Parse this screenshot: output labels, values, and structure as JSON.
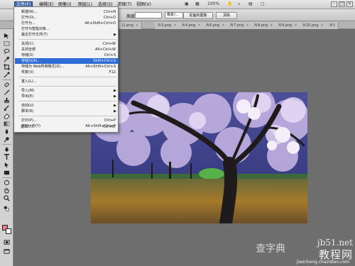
{
  "menubar": {
    "items": [
      "文件(F)",
      "编辑(E)",
      "图像(I)",
      "图层(L)",
      "选择(S)",
      "滤镜(T)",
      "视图(V)"
    ],
    "zoom": "100%"
  },
  "options_bar": {
    "feather_label": "羽化:",
    "style_label": "样式:",
    "width_label": "宽度:",
    "height_label": "高度:",
    "mode_select": "像素/...",
    "front_image_btn": "前面的图像",
    "clear_btn": "清除"
  },
  "tabs": [
    "J1.png",
    "片3.png",
    "片4.png",
    "片6.png",
    "片7.png",
    "片8.png",
    "片9.png",
    "片10.png",
    "片1"
  ],
  "file_menu": {
    "items": [
      {
        "label": "新建(N)...",
        "shortcut": "Ctrl+N"
      },
      {
        "label": "打开(O)...",
        "shortcut": "Ctrl+O"
      },
      {
        "label": "打开为...",
        "shortcut": "Alt+Shift+Ctrl+O"
      },
      {
        "label": "打开为智能对象...",
        "shortcut": ""
      },
      {
        "label": "最近打开文件(T)",
        "shortcut": ""
      },
      {
        "label": "关闭(C)",
        "shortcut": "Ctrl+W"
      },
      {
        "label": "关闭全部",
        "shortcut": "Alt+Ctrl+W"
      },
      {
        "label": "存储(S)",
        "shortcut": "Ctrl+S"
      },
      {
        "label": "存储为(A)...",
        "shortcut": "Shift+Ctrl+S"
      },
      {
        "label": "存储为 Web所用格式(D)...",
        "shortcut": "Alt+Shift+Ctrl+S"
      },
      {
        "label": "恢复(V)",
        "shortcut": "F12"
      },
      {
        "label": "置入(L)...",
        "shortcut": ""
      },
      {
        "label": "导入(M)",
        "shortcut": ""
      },
      {
        "label": "导出(E)",
        "shortcut": ""
      },
      {
        "label": "自动(U)",
        "shortcut": ""
      },
      {
        "label": "脚本(R)",
        "shortcut": ""
      },
      {
        "label": "打印(P)...",
        "shortcut": "Ctrl+P"
      },
      {
        "label": "打印一份(Y)",
        "shortcut": "Alt+Shift+Ctrl+P"
      },
      {
        "label": "退出(X)",
        "shortcut": "Ctrl+Q"
      }
    ]
  },
  "watermark": {
    "site": "jb51.net",
    "title": "教程网",
    "left_text": "查字典",
    "url": "jiaocheng.chazidian.com"
  },
  "colors": {
    "foreground": "#e8788a",
    "background": "#ffffff",
    "menu_highlight": "#2f6bd4"
  },
  "icons": [
    "move-icon",
    "marquee-icon",
    "lasso-icon",
    "magic-wand-icon",
    "crop-icon",
    "eyedropper-icon",
    "healing-brush-icon",
    "brush-icon",
    "clone-stamp-icon",
    "history-brush-icon",
    "eraser-icon",
    "gradient-icon",
    "blur-icon",
    "dodge-icon",
    "pen-icon",
    "type-icon",
    "path-select-icon",
    "shape-icon",
    "hand-icon",
    "zoom-icon"
  ]
}
